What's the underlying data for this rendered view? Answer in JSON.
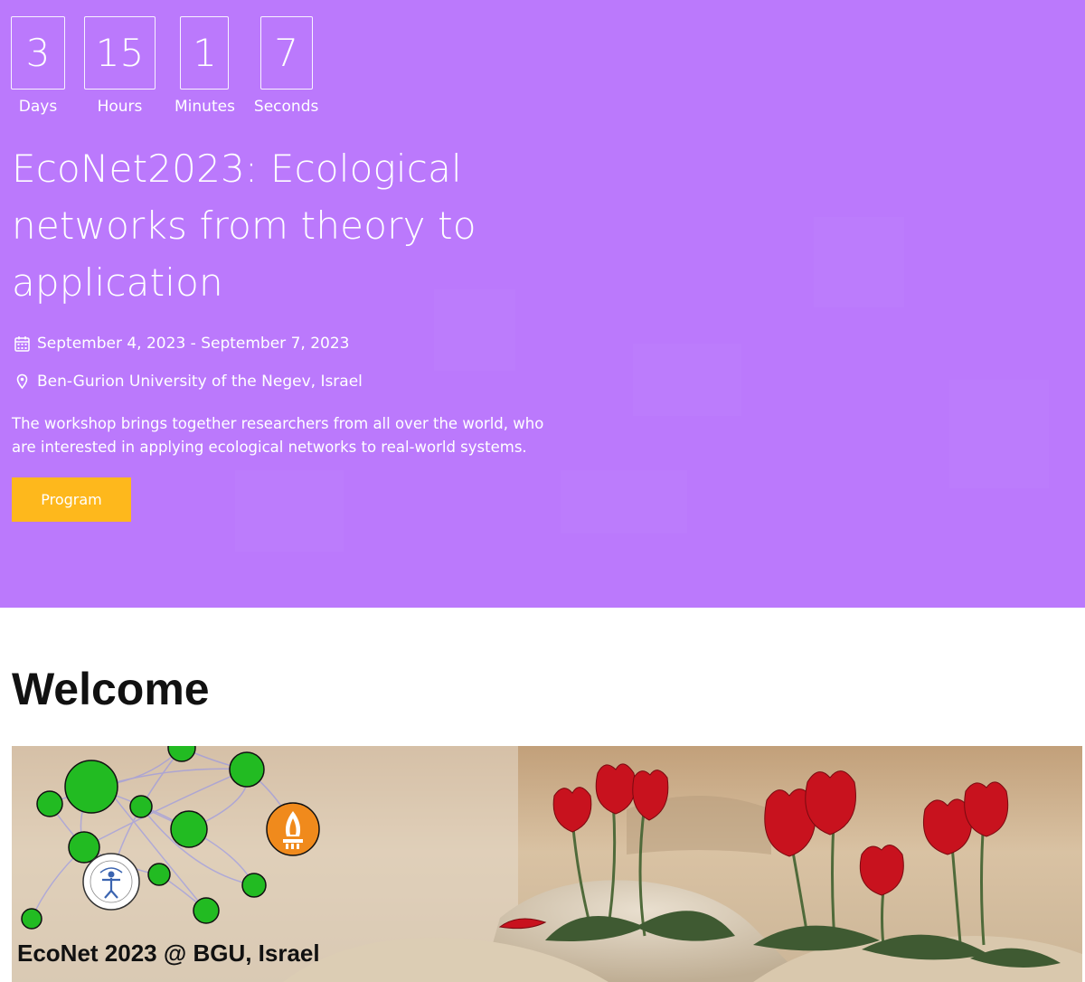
{
  "countdown": {
    "days": {
      "value": "3",
      "label": "Days"
    },
    "hours": {
      "value": "15",
      "label": "Hours"
    },
    "minutes": {
      "value": "1",
      "label": "Minutes"
    },
    "seconds": {
      "value": "7",
      "label": "Seconds"
    }
  },
  "hero": {
    "title": "EcoNet2023: Ecological networks from theory to application",
    "date": "September 4, 2023 - September 7, 2023",
    "location": "Ben-Gurion University of the Negev, Israel",
    "description": "The workshop brings together researchers from all over the world, who are interested in applying ecological networks to real-world systems.",
    "button_label": "Program"
  },
  "welcome": {
    "heading": "Welcome",
    "banner_caption": "EcoNet 2023 @ BGU, Israel"
  },
  "colors": {
    "hero_bg": "#bb79fc",
    "button_bg": "#feb81c",
    "node_green": "#22bb22",
    "bgu_orange": "#f08a1c",
    "flower_red": "#c8121e"
  },
  "icons": {
    "date": "calendar-icon",
    "location": "map-marker-icon"
  }
}
